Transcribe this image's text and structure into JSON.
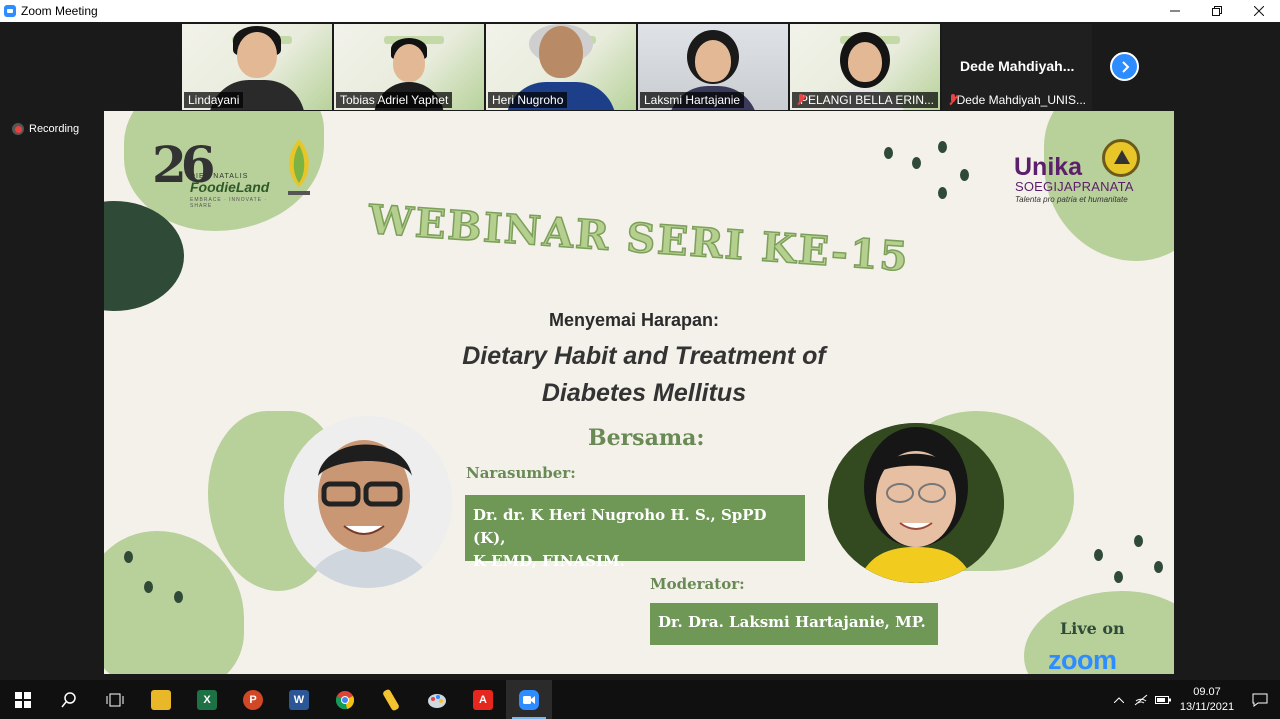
{
  "window": {
    "title": "Zoom Meeting",
    "minimize_icon": "minimize-icon",
    "restore_icon": "restore-icon",
    "close_icon": "close-icon"
  },
  "participants": [
    {
      "name": "Lindayani",
      "muted": false
    },
    {
      "name": "Tobias Adriel Yaphet",
      "muted": false,
      "active_speaker": true
    },
    {
      "name": "Heri Nugroho",
      "muted": false
    },
    {
      "name": "Laksmi Hartajanie",
      "muted": false
    },
    {
      "name": "PELANGI BELLA ERIN...",
      "muted": true
    },
    {
      "name": "Dede Mahdiyah_UNIS...",
      "display_name": "Dede  Mahdiyah...",
      "muted": true,
      "video_off": true
    }
  ],
  "recording": {
    "label": "Recording"
  },
  "slide": {
    "logo_left_number": "26",
    "logo_left_line1": "DIES NATALIS",
    "logo_left_line2": "FoodieLand",
    "logo_left_line3": "EMBRACE · INNOVATE · SHARE",
    "logo_right_name": "Unika",
    "logo_right_sub": "SOEGIJAPRANATA",
    "logo_right_motto": "Talenta pro patria et humanitate",
    "title": "WEBINAR SERI KE-15",
    "subtitle": "Menyemai Harapan:",
    "topic_line1": "Dietary Habit and Treatment of",
    "topic_line2": "Diabetes Mellitus",
    "bersama": "Bersama:",
    "speaker_label": "Narasumber:",
    "speaker_line1": "Dr. dr. K Heri Nugroho H. S., SpPD (K),",
    "speaker_line2": "K-EMD, FINASIM.",
    "moderator_label": "Moderator:",
    "moderator_name": "Dr. Dra. Laksmi Hartajanie, MP.",
    "live_on": "Live on",
    "platform": "zoom"
  },
  "taskbar": {
    "apps": [
      "start-icon",
      "search-icon",
      "task-view-icon",
      "file-explorer-icon",
      "excel-icon",
      "powerpoint-icon",
      "word-icon",
      "chrome-icon",
      "sticky-app-icon",
      "paint-icon",
      "acrobat-icon",
      "zoom-icon"
    ],
    "time": "09.07",
    "date": "13/11/2021"
  },
  "colors": {
    "zoom_blue": "#2d8cff",
    "slide_green": "#6f9857",
    "slide_light_green": "#b8d09a",
    "slide_dark_green": "#2f4a36"
  }
}
